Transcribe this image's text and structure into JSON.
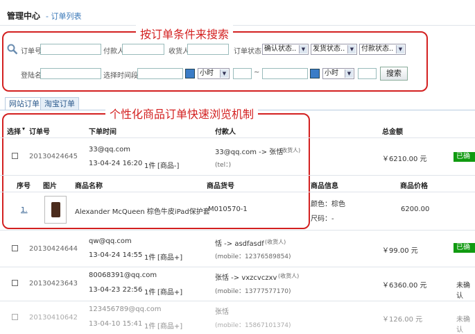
{
  "header": {
    "title": "管理中心",
    "subtitle": "- 订单列表"
  },
  "annotations": {
    "search": "按订单条件来搜索",
    "browse": "个性化商品订单快速浏览机制"
  },
  "search": {
    "order_no_label": "订单号",
    "payer_label": "付款人",
    "receiver_label": "收货人",
    "status_label": "订单状态",
    "confirm_status": "确认状态..",
    "ship_status": "发货状态..",
    "pay_status": "付款状态..",
    "login_label": "登陆名",
    "time_label": "选择时间段",
    "hour1": "小时",
    "tilde": "~",
    "hour2": "小时",
    "search_button": "搜索"
  },
  "tabs": [
    "网站订单",
    "淘宝订单"
  ],
  "table": {
    "headers": {
      "select": "选择",
      "select_arrow": "▾",
      "order_no": "订单号",
      "time": "下单时间",
      "payer": "付款人",
      "total": "总金额"
    },
    "rows": [
      {
        "id": "20130424645",
        "email": "33@qq.com",
        "time": "13-04-24 16:20",
        "qty": "1件",
        "goods": "[商品-]",
        "payer": "33@qq.com -> 张恬",
        "recv_tag": "(收货人)",
        "contact": "(tel：)",
        "amount": "￥6210.00 元",
        "status": "已确认"
      },
      {
        "id": "20130424644",
        "email": "qw@qq.com",
        "time": "13-04-24 14:55",
        "qty": "1件",
        "goods": "[商品+]",
        "payer": "恬 -> asdfasdf",
        "recv_tag": "(收货人)",
        "contact": "(mobile：12376589854)",
        "amount": "￥99.00 元",
        "status": "已确认"
      },
      {
        "id": "20130423643",
        "email": "80068391@qq.com",
        "time": "13-04-23 22:56",
        "qty": "1件",
        "goods": "[商品+]",
        "payer": "张恬 -> vxzcvczxv",
        "recv_tag": "(收货人)",
        "contact": "(mobile：13777577170)",
        "amount": "￥6360.00 元",
        "status": "未确认"
      },
      {
        "id": "20130410642",
        "email": "123456789@qq.com",
        "time": "13-04-10 15:41",
        "qty": "1件",
        "goods": "[商品+]",
        "payer": "张恬",
        "recv_tag": "",
        "contact": "(mobile：15867101374)",
        "amount": "￥126.00 元",
        "status": "未确认"
      }
    ]
  },
  "detail": {
    "headers": {
      "seq": "序号",
      "image": "图片",
      "name": "商品名称",
      "sku": "商品货号",
      "info": "商品信息",
      "price": "商品价格"
    },
    "item": {
      "seq": "1.",
      "name": "Alexander McQueen 棕色牛皮iPad保护套",
      "sku": "M010570-1",
      "color": "颜色：棕色",
      "size": "尺码：-",
      "price": "6200.00"
    }
  }
}
